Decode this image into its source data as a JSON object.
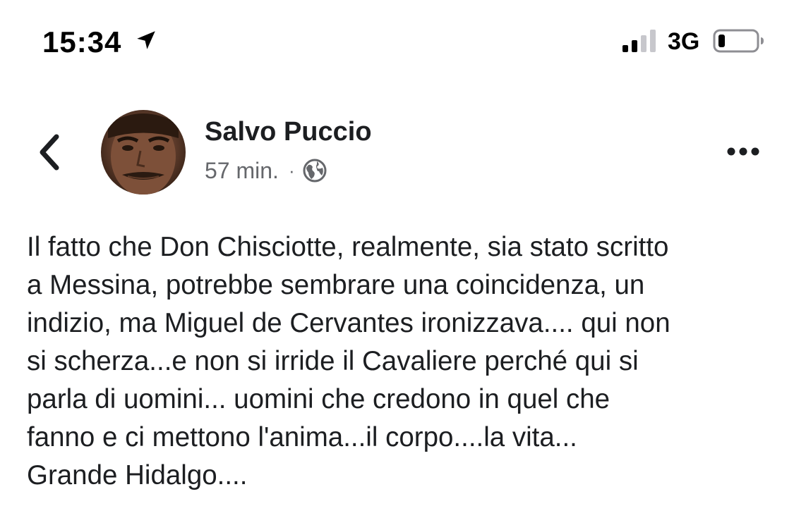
{
  "status_bar": {
    "time": "15:34",
    "network": "3G",
    "icons": [
      "location-arrow-icon",
      "signal-icon",
      "battery-icon"
    ]
  },
  "post": {
    "author": "Salvo Puccio",
    "time": "57 min.",
    "separator": "·",
    "privacy_icon": "globe-icon",
    "lines": [
      "Il fatto che Don Chisciotte, realmente, sia stato scritto",
      "a Messina, potrebbe sembrare una coincidenza, un",
      "indizio, ma Miguel de Cervantes ironizzava.... qui non",
      "si scherza...e non si irride il Cavaliere perché qui si",
      "parla di uomini... uomini che credono in quel che",
      "fanno e ci mettono l'anima...il corpo....la vita...",
      "Grande Hidalgo...."
    ]
  },
  "colors": {
    "text": "#1c1e21",
    "secondary_text": "#65676b",
    "background": "#ffffff"
  }
}
